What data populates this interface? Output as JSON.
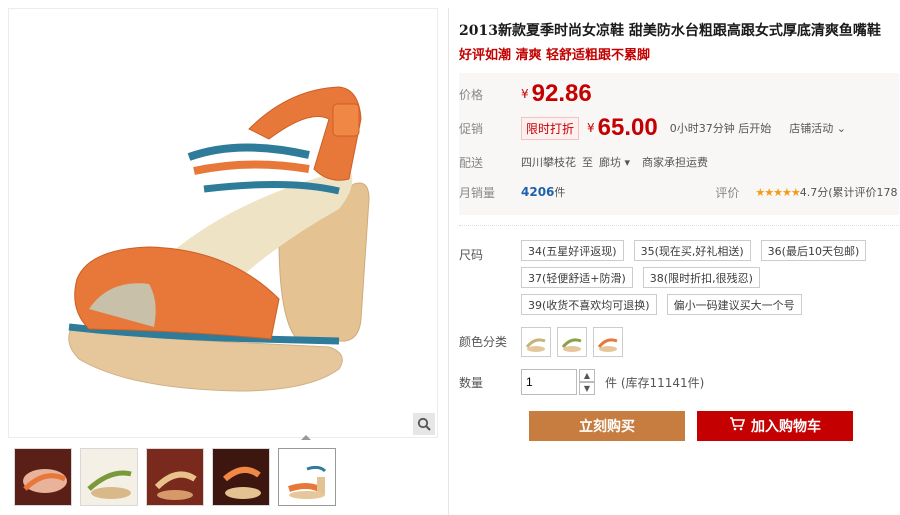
{
  "product": {
    "title": "2013新款夏季时尚女凉鞋 甜美防水台粗跟高跟女式厚底清爽鱼嘴鞋",
    "subtitle": "好评如潮 清爽 轻舒适粗跟不累脚"
  },
  "price": {
    "label": "价格",
    "currency": "¥",
    "original": "92.86"
  },
  "promo": {
    "label": "促销",
    "tag": "限时打折",
    "currency": "¥",
    "price": "65.00",
    "countdown": "0小时37分钟 后开始",
    "shop_activity": "店铺活动"
  },
  "shipping": {
    "label": "配送",
    "from": "四川攀枝花",
    "to_prefix": "至",
    "to": "廊坊",
    "fee": "商家承担运费"
  },
  "sales": {
    "label": "月销量",
    "count": "4206",
    "unit": "件",
    "rating_label": "评价",
    "stars": "★★★★★",
    "rating_text": "4.7分(累计评价178"
  },
  "options": {
    "size_label": "尺码",
    "sizes": [
      "34(五星好评返现)",
      "35(现在买,好礼相送)",
      "36(最后10天包邮)",
      "37(轻便舒适+防滑)",
      "38(限时折扣,很残忍)",
      "39(收货不喜欢均可退换)",
      "偏小一码建议买大一个号"
    ],
    "color_label": "颜色分类"
  },
  "quantity": {
    "label": "数量",
    "value": "1",
    "unit_stock": "件 (库存11141件)"
  },
  "actions": {
    "buy": "立刻购买",
    "cart": "加入购物车"
  },
  "colors_meta": {
    "accent_red": "#c40000",
    "buy_button": "#c77d40",
    "link_blue": "#1f62ab"
  }
}
